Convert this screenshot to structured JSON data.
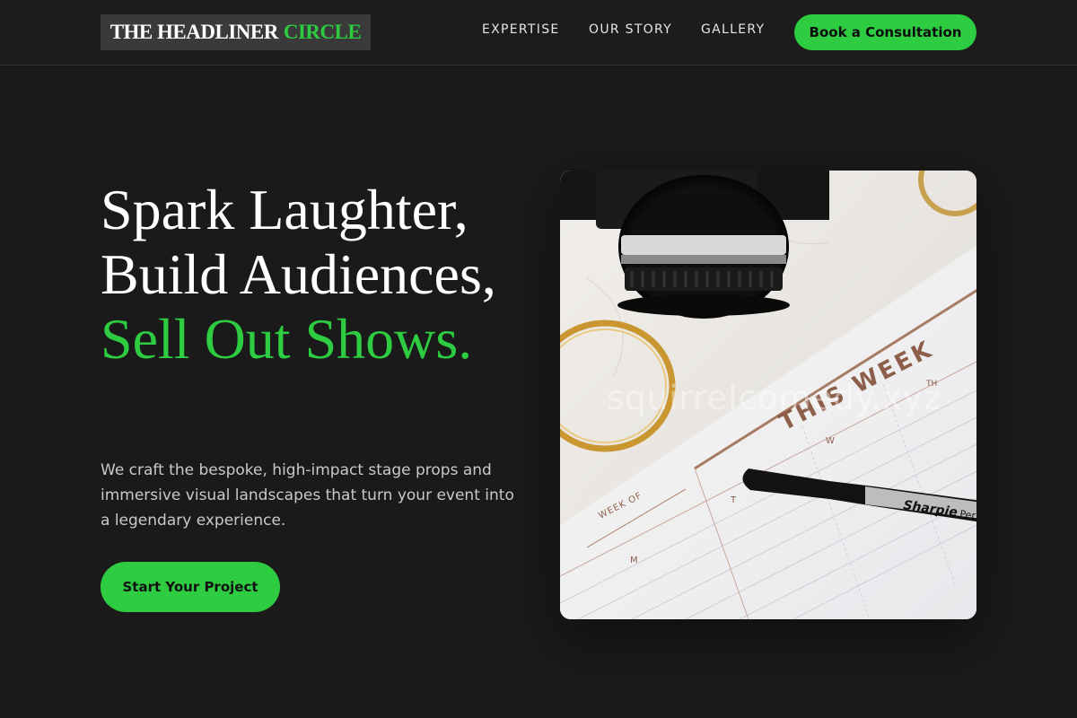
{
  "brand": {
    "logo_part1": "THE HEADLINER",
    "logo_part2": "CIRCLE"
  },
  "nav": {
    "links": [
      "EXPERTISE",
      "OUR STORY",
      "GALLERY"
    ],
    "cta_label": "Book a Consultation"
  },
  "hero": {
    "headline_white": "Spark Laughter, Build Audiences,",
    "headline_green": "Sell Out Shows.",
    "lede": "We craft the bespoke, high-impact stage props and immersive visual landscapes that turn your event into a legendary experience.",
    "cta_label": "Start Your Project"
  },
  "image": {
    "planner_title": "THIS WEEK",
    "planner_week_of": "WEEK OF",
    "planner_days": [
      "M",
      "T",
      "W",
      "TH"
    ],
    "pen_brand": "Sharpie",
    "pen_suffix": "Per",
    "watermark": "squirrelcomedy.xyz"
  },
  "colors": {
    "background": "#1a1a1a",
    "accent": "#2ecc40",
    "text_primary": "#ffffff",
    "text_secondary": "#c9c9c9"
  }
}
